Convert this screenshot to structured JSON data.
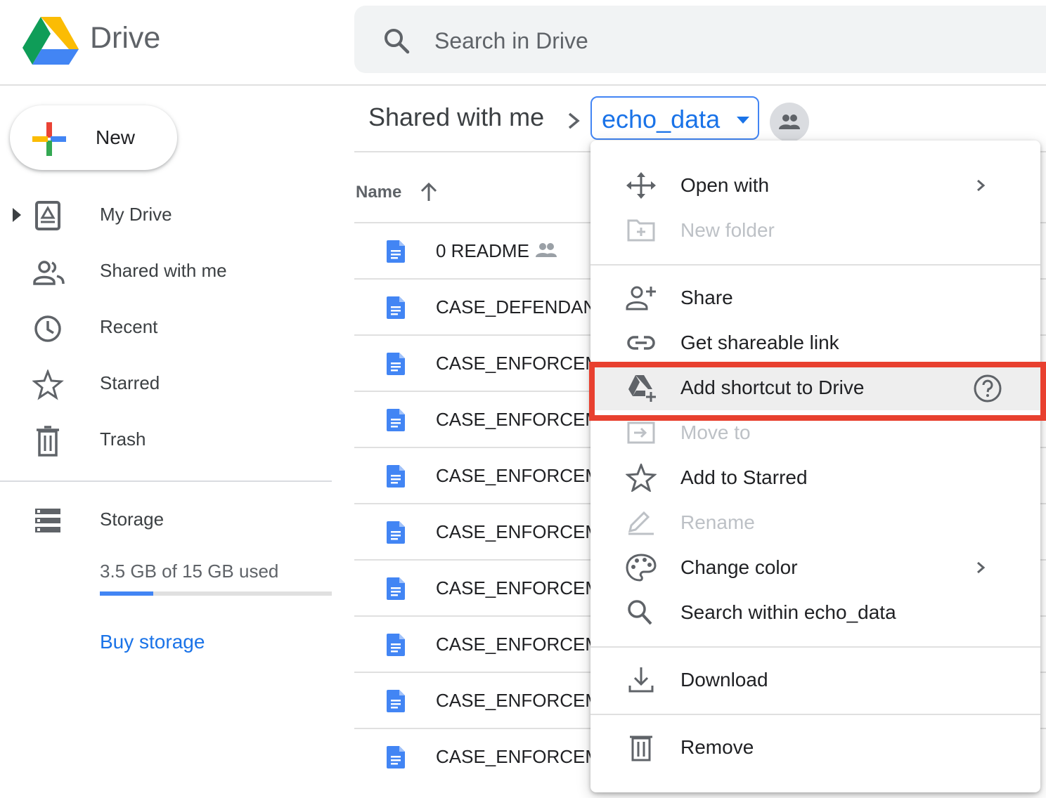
{
  "header": {
    "app_title": "Drive",
    "search_placeholder": "Search in Drive"
  },
  "sidebar": {
    "new_label": "New",
    "items": [
      {
        "label": "My Drive",
        "icon": "my-drive-icon"
      },
      {
        "label": "Shared with me",
        "icon": "people-icon"
      },
      {
        "label": "Recent",
        "icon": "clock-icon"
      },
      {
        "label": "Starred",
        "icon": "star-icon"
      },
      {
        "label": "Trash",
        "icon": "trash-icon"
      }
    ],
    "storage": {
      "label": "Storage",
      "usage": "3.5 GB of 15 GB used",
      "used_fraction": 0.23,
      "buy_label": "Buy storage"
    }
  },
  "breadcrumb": {
    "parent": "Shared with me",
    "current": "echo_data"
  },
  "file_list": {
    "column_name": "Name",
    "rows": [
      {
        "name": "0 README",
        "shared": true
      },
      {
        "name": "CASE_DEFENDANT"
      },
      {
        "name": "CASE_ENFORCEMI"
      },
      {
        "name": "CASE_ENFORCEMI"
      },
      {
        "name": "CASE_ENFORCEME"
      },
      {
        "name": "CASE_ENFORCEME"
      },
      {
        "name": "CASE_ENFORCEME"
      },
      {
        "name": "CASE_ENFORCEME"
      },
      {
        "name": "CASE_ENFORCEME"
      },
      {
        "name": "CASE_ENFORCEME"
      }
    ]
  },
  "context_menu": {
    "items": {
      "open_with": "Open with",
      "new_folder": "New folder",
      "share": "Share",
      "get_link": "Get shareable link",
      "add_shortcut": "Add shortcut to Drive",
      "move_to": "Move to",
      "add_starred": "Add to Starred",
      "rename": "Rename",
      "change_color": "Change color",
      "search_within": "Search within echo_data",
      "download": "Download",
      "remove": "Remove"
    }
  },
  "colors": {
    "accent_blue": "#1a73e8",
    "highlight_red": "#e8402f"
  }
}
